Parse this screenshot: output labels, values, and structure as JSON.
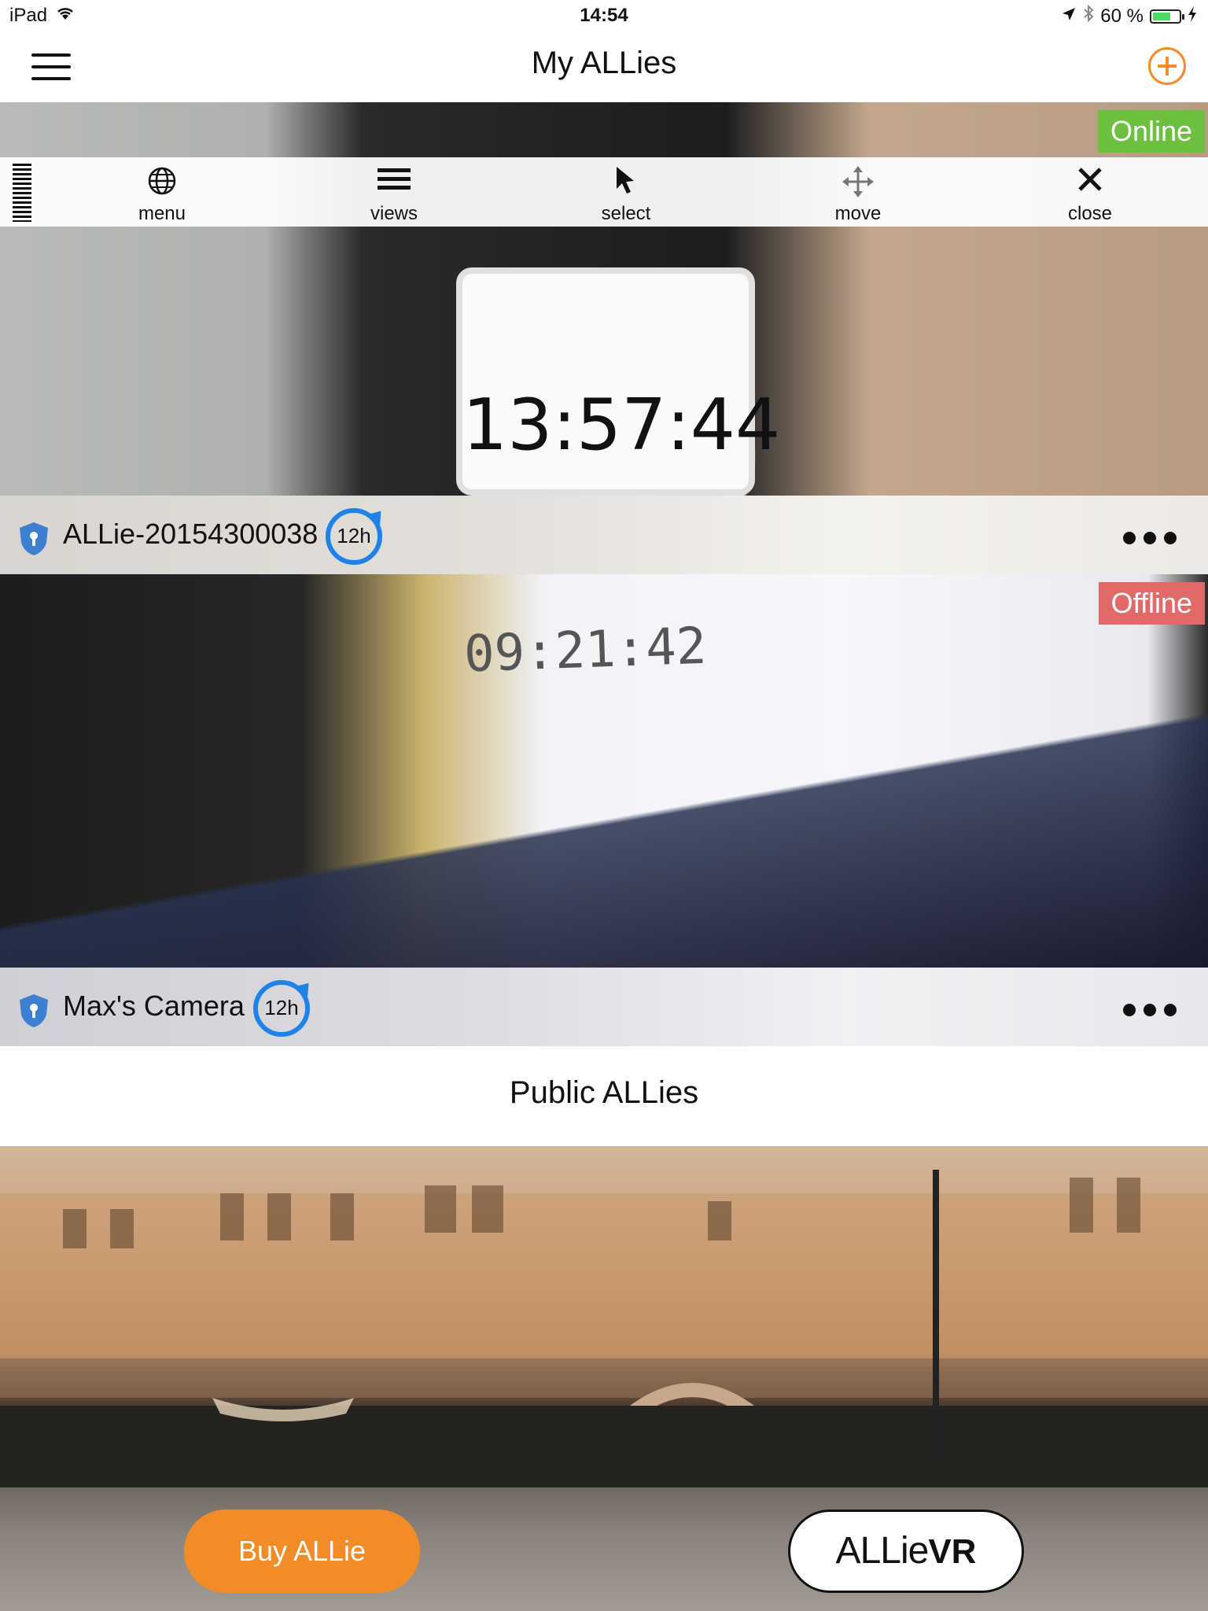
{
  "status_bar": {
    "device": "iPad",
    "time": "14:54",
    "battery": "60 %"
  },
  "nav": {
    "title": "My ALLies"
  },
  "toolbar": {
    "items": [
      {
        "label": "menu",
        "icon": "globe-icon"
      },
      {
        "label": "views",
        "icon": "list-icon"
      },
      {
        "label": "select",
        "icon": "cursor-icon"
      },
      {
        "label": "move",
        "icon": "move-icon"
      },
      {
        "label": "close",
        "icon": "close-icon"
      }
    ]
  },
  "cameras": [
    {
      "name": "ALLie-20154300038",
      "status": "Online",
      "status_color": "#6cbf3f",
      "timer": "12h",
      "video_time": "13:57:44"
    },
    {
      "name": "Max's Camera",
      "status": "Offline",
      "status_color": "#e06a68",
      "timer": "12h",
      "video_time": "09:21:42"
    }
  ],
  "public_section": {
    "title": "Public ALLies"
  },
  "bottom": {
    "buy_label": "Buy  ALLie",
    "vr_label_a": "ALLie",
    "vr_label_b": "VR"
  },
  "colors": {
    "accent": "#f28c28",
    "timer_blue": "#1e82e6",
    "shield_blue": "#3d7fd0"
  }
}
